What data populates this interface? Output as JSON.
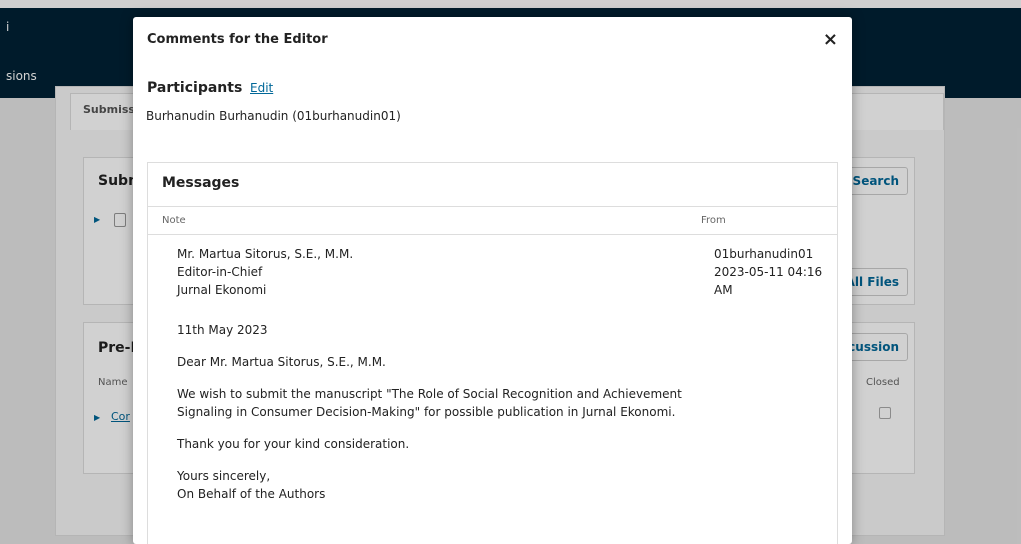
{
  "background": {
    "brand_fragment": "i",
    "nav_fragment": "sions",
    "tab_fragment": "Submiss",
    "files_grid": {
      "title_fragment": "Subm",
      "search_button": "Search",
      "all_files_button": "All Files"
    },
    "discussion_grid": {
      "title_fragment": "Pre-F",
      "add_button_fragment": "cussion",
      "col_name": "Name",
      "col_closed": "Closed",
      "row_link_fragment": "Cor"
    }
  },
  "modal": {
    "title": "Comments for the Editor",
    "close_glyph": "×",
    "participants": {
      "heading": "Participants",
      "edit_label": "Edit",
      "names": "Burhanudin Burhanudin (01burhanudin01)"
    },
    "messages": {
      "heading": "Messages",
      "col_note": "Note",
      "col_from": "From",
      "note": {
        "signature_name": "Mr. Martua Sitorus, S.E., M.M.",
        "signature_role": "Editor-in-Chief",
        "signature_journal": "Jurnal Ekonomi",
        "date_line": "11th May 2023",
        "salutation": "Dear Mr. Martua Sitorus, S.E., M.M.",
        "body_line1": "We wish to submit the manuscript \"The Role of Social Recognition and Achievement",
        "body_line2": "Signaling in Consumer Decision-Making\" for possible publication in Jurnal Ekonomi.",
        "thanks": "Thank you for your kind consideration.",
        "closing": "Yours sincerely,",
        "closing_by": "On Behalf of the Authors"
      },
      "from": {
        "user": "01burhanudin01",
        "date": "2023-05-11 04:16",
        "ampm": "AM"
      }
    }
  },
  "colors": {
    "header_bg": "#002235",
    "link": "#006798"
  }
}
